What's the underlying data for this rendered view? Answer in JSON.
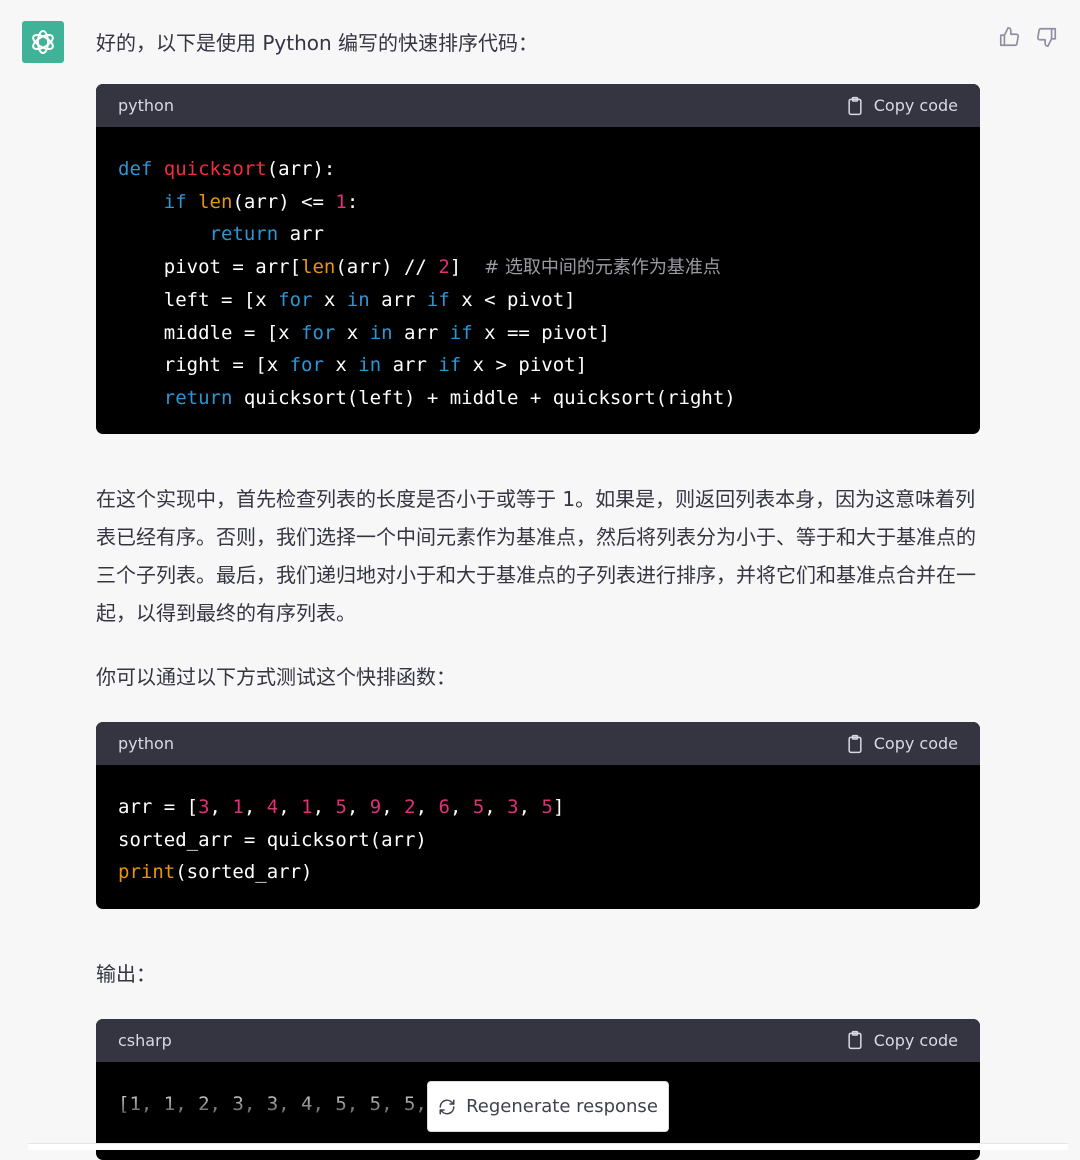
{
  "intro": "好的，以下是使用 Python 编写的快速排序代码：",
  "code1": {
    "language": "python",
    "copy_label": "Copy code",
    "lines": [
      [
        [
          "kw",
          "def"
        ],
        [
          "t",
          " "
        ],
        [
          "fn",
          "quicksort"
        ],
        [
          "t",
          "(arr):"
        ]
      ],
      [
        [
          "t",
          "    "
        ],
        [
          "kw",
          "if"
        ],
        [
          "t",
          " "
        ],
        [
          "bi",
          "len"
        ],
        [
          "t",
          "(arr) <= "
        ],
        [
          "num",
          "1"
        ],
        [
          "t",
          ":"
        ]
      ],
      [
        [
          "t",
          "        "
        ],
        [
          "kw",
          "return"
        ],
        [
          "t",
          " arr"
        ]
      ],
      [
        [
          "t",
          "    pivot = arr["
        ],
        [
          "bi",
          "len"
        ],
        [
          "t",
          "(arr) // "
        ],
        [
          "num",
          "2"
        ],
        [
          "t",
          "]  "
        ],
        [
          "cm",
          "# 选取中间的元素作为基准点"
        ]
      ],
      [
        [
          "t",
          "    left = [x "
        ],
        [
          "kw",
          "for"
        ],
        [
          "t",
          " x "
        ],
        [
          "kw",
          "in"
        ],
        [
          "t",
          " arr "
        ],
        [
          "kw",
          "if"
        ],
        [
          "t",
          " x < pivot]"
        ]
      ],
      [
        [
          "t",
          "    middle = [x "
        ],
        [
          "kw",
          "for"
        ],
        [
          "t",
          " x "
        ],
        [
          "kw",
          "in"
        ],
        [
          "t",
          " arr "
        ],
        [
          "kw",
          "if"
        ],
        [
          "t",
          " x == pivot]"
        ]
      ],
      [
        [
          "t",
          "    right = [x "
        ],
        [
          "kw",
          "for"
        ],
        [
          "t",
          " x "
        ],
        [
          "kw",
          "in"
        ],
        [
          "t",
          " arr "
        ],
        [
          "kw",
          "if"
        ],
        [
          "t",
          " x > pivot]"
        ]
      ],
      [
        [
          "t",
          "    "
        ],
        [
          "kw",
          "return"
        ],
        [
          "t",
          " quicksort(left) + middle + quicksort(right)"
        ]
      ]
    ]
  },
  "explanation": "在这个实现中，首先检查列表的长度是否小于或等于 1。如果是，则返回列表本身，因为这意味着列表已经有序。否则，我们选择一个中间元素作为基准点，然后将列表分为小于、等于和大于基准点的三个子列表。最后，我们递归地对小于和大于基准点的子列表进行排序，并将它们和基准点合并在一起，以得到最终的有序列表。",
  "test_intro": "你可以通过以下方式测试这个快排函数：",
  "code2": {
    "language": "python",
    "copy_label": "Copy code",
    "lines": [
      [
        [
          "t",
          "arr = ["
        ],
        [
          "num",
          "3"
        ],
        [
          "t",
          ", "
        ],
        [
          "num",
          "1"
        ],
        [
          "t",
          ", "
        ],
        [
          "num",
          "4"
        ],
        [
          "t",
          ", "
        ],
        [
          "num",
          "1"
        ],
        [
          "t",
          ", "
        ],
        [
          "num",
          "5"
        ],
        [
          "t",
          ", "
        ],
        [
          "num",
          "9"
        ],
        [
          "t",
          ", "
        ],
        [
          "num",
          "2"
        ],
        [
          "t",
          ", "
        ],
        [
          "num",
          "6"
        ],
        [
          "t",
          ", "
        ],
        [
          "num",
          "5"
        ],
        [
          "t",
          ", "
        ],
        [
          "num",
          "3"
        ],
        [
          "t",
          ", "
        ],
        [
          "num",
          "5"
        ],
        [
          "t",
          "]"
        ]
      ],
      [
        [
          "t",
          "sorted_arr = quicksort(arr)"
        ]
      ],
      [
        [
          "bi",
          "print"
        ],
        [
          "t",
          "(sorted_arr)"
        ]
      ]
    ]
  },
  "output_label": "输出：",
  "code3": {
    "language": "csharp",
    "copy_label": "Copy code",
    "lines": [
      [
        [
          "t",
          "[1, 1, 2, 3, 3, 4, 5, 5, 5,"
        ]
      ]
    ]
  },
  "regenerate_label": "Regenerate response",
  "icons": {
    "avatar": "openai-logo-icon",
    "like": "thumbs-up-icon",
    "dislike": "thumbs-down-icon",
    "copy": "clipboard-icon",
    "regenerate": "refresh-icon"
  },
  "colors": {
    "avatar_bg": "#10a37f",
    "code_header_bg": "#343541",
    "code_bg": "#000000",
    "keyword": "#2e95d3",
    "function": "#f22c3d",
    "builtin": "#e9950c",
    "number": "#df3079",
    "comment": "#9b9ba4"
  }
}
